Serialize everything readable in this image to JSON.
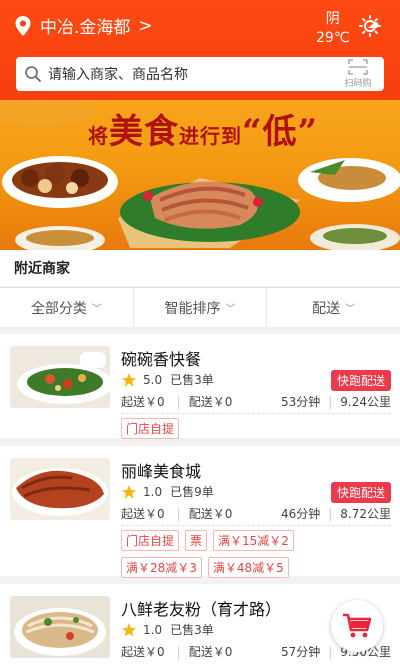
{
  "header": {
    "location": "中冶.金海都",
    "weather_condition": "阴",
    "temperature": "29℃",
    "search_placeholder": "请输入商家、商品名称",
    "scan_label": "扫码购"
  },
  "banner": {
    "text_part1": "将",
    "text_part2": "美食",
    "text_part3": "进行到",
    "text_part4": "“低”"
  },
  "nearby": {
    "title": "附近商家"
  },
  "filters": [
    {
      "label": "全部分类"
    },
    {
      "label": "智能排序"
    },
    {
      "label": "配送"
    }
  ],
  "merchants": [
    {
      "name": "碗碗香快餐",
      "rating": "5.0",
      "sold": "已售3单",
      "delivery_tag": "快跑配送",
      "start_price": "起送￥0",
      "delivery_fee": "配送￥0",
      "time": "53分钟",
      "distance": "9.24公里",
      "tags": [
        "门店自提"
      ]
    },
    {
      "name": "丽峰美食城",
      "rating": "1.0",
      "sold": "已售9单",
      "delivery_tag": "快跑配送",
      "start_price": "起送￥0",
      "delivery_fee": "配送￥0",
      "time": "46分钟",
      "distance": "8.72公里",
      "tags": [
        "门店自提",
        "票",
        "满￥15减￥2",
        "满￥28减￥3",
        "满￥48减￥5"
      ]
    },
    {
      "name": "八鲜老友粉（育才路）",
      "rating": "1.0",
      "sold": "已售3单",
      "delivery_tag": "",
      "start_price": "起送￥0",
      "delivery_fee": "配送￥0",
      "time": "57分钟",
      "distance": "9.50公里",
      "tags": []
    }
  ],
  "colors": {
    "brand": "#f63f0e",
    "tag_red": "#ec3a4d",
    "star": "#f7b515"
  },
  "icons": {
    "location": "location-pin-icon",
    "weather": "weather-icon",
    "search": "search-icon",
    "scan": "scan-icon",
    "star": "star-icon",
    "cart": "cart-icon"
  }
}
